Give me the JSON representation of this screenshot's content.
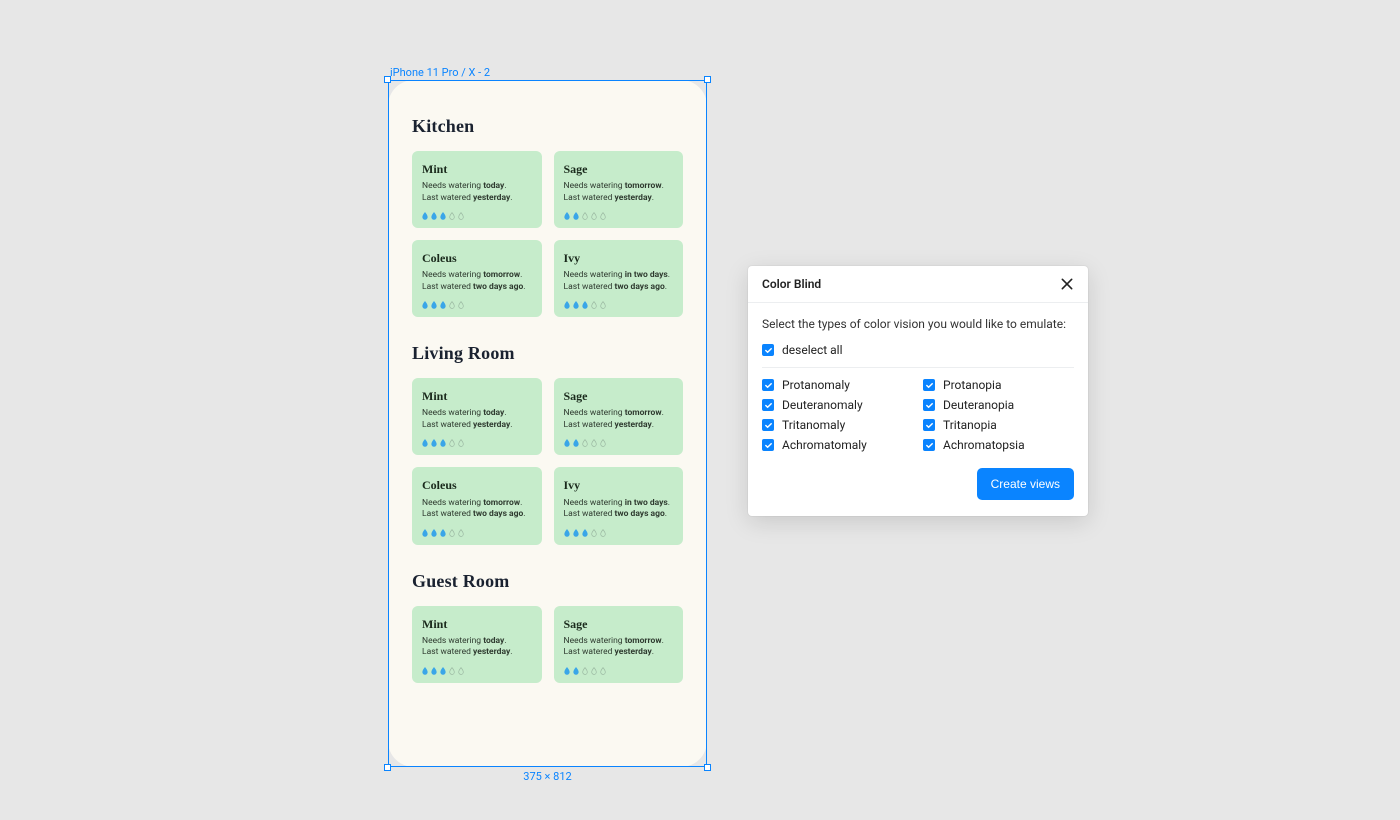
{
  "frame": {
    "label": "iPhone 11 Pro / X - 2",
    "dimensions": "375 × 812"
  },
  "mock": {
    "rooms": [
      {
        "title": "Kitchen",
        "plants": [
          {
            "name": "Mint",
            "needs_when": "today",
            "last_when": "yesterday",
            "drops_filled": 3,
            "drops_total": 5
          },
          {
            "name": "Sage",
            "needs_when": "tomorrow",
            "last_when": "yesterday",
            "drops_filled": 2,
            "drops_total": 5
          },
          {
            "name": "Coleus",
            "needs_when": "tomorrow",
            "last_when": "two days ago",
            "drops_filled": 3,
            "drops_total": 5
          },
          {
            "name": "Ivy",
            "needs_when": "in two days",
            "last_when": "two days ago",
            "drops_filled": 3,
            "drops_total": 5
          }
        ]
      },
      {
        "title": "Living Room",
        "plants": [
          {
            "name": "Mint",
            "needs_when": "today",
            "last_when": "yesterday",
            "drops_filled": 3,
            "drops_total": 5
          },
          {
            "name": "Sage",
            "needs_when": "tomorrow",
            "last_when": "yesterday",
            "drops_filled": 2,
            "drops_total": 5
          },
          {
            "name": "Coleus",
            "needs_when": "tomorrow",
            "last_when": "two days ago",
            "drops_filled": 3,
            "drops_total": 5
          },
          {
            "name": "Ivy",
            "needs_when": "in two days",
            "last_when": "two days ago",
            "drops_filled": 3,
            "drops_total": 5
          }
        ]
      },
      {
        "title": "Guest Room",
        "plants": [
          {
            "name": "Mint",
            "needs_when": "today",
            "last_when": "yesterday",
            "drops_filled": 3,
            "drops_total": 5
          },
          {
            "name": "Sage",
            "needs_when": "tomorrow",
            "last_when": "yesterday",
            "drops_filled": 2,
            "drops_total": 5
          }
        ]
      }
    ],
    "strings": {
      "needs_prefix": "Needs watering ",
      "last_prefix": "Last watered "
    }
  },
  "panel": {
    "title": "Color Blind",
    "description": "Select the types of color vision you would like to emulate:",
    "deselect_label": "deselect all",
    "options_left": [
      "Protanomaly",
      "Deuteranomaly",
      "Tritanomaly",
      "Achromatomaly"
    ],
    "options_right": [
      "Protanopia",
      "Deuteranopia",
      "Tritanopia",
      "Achromatopsia"
    ],
    "button": "Create views"
  }
}
